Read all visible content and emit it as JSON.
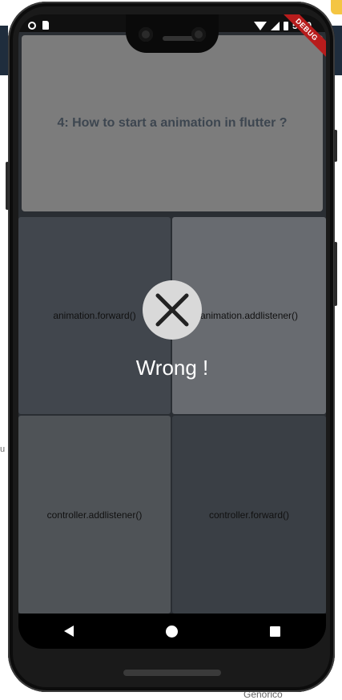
{
  "status_bar": {
    "time": "5:00"
  },
  "debug_banner": "DEBUG",
  "question": {
    "text": "4: How to start a animation in flutter ?"
  },
  "options": [
    {
      "label": "animation.forward()"
    },
    {
      "label": "animation.addlistener()"
    },
    {
      "label": "controller.addlistener()"
    },
    {
      "label": "controller.forward()"
    }
  ],
  "feedback": {
    "icon": "close-icon",
    "text": "Wrong !"
  },
  "background_page": {
    "footer_text": "Genorico",
    "left_char": "u"
  },
  "nav_bar": {
    "icons": [
      "back-icon",
      "home-icon",
      "recents-icon"
    ]
  }
}
